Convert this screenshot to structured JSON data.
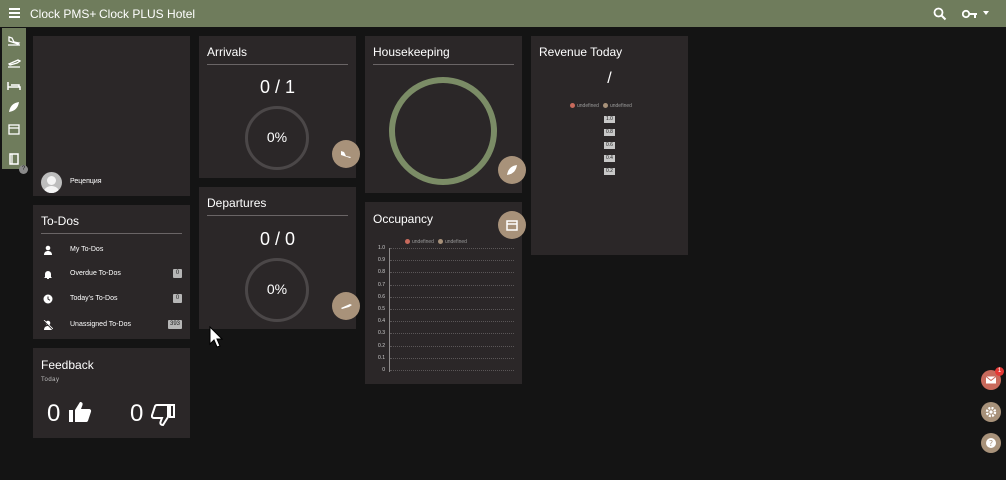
{
  "header": {
    "menu_icon": "menu-icon",
    "app_name": "Clock PMS+",
    "hotel_name": "Clock PLUS Hotel",
    "search_icon": "search-icon",
    "key_icon": "key-icon",
    "caret_icon": "caret-down-icon",
    "bar_color": "#6f7c5c"
  },
  "rail": {
    "items": [
      "plane-landing-icon",
      "plane-takeoff-icon",
      "bed-icon",
      "leaf-icon",
      "calendar-icon",
      "book-icon"
    ],
    "help_badge": "?"
  },
  "profile": {
    "user_name": "Рецепция"
  },
  "todos": {
    "title": "To-Dos",
    "items": [
      {
        "label": "My To-Dos",
        "icon": "person-icon",
        "badge": ""
      },
      {
        "label": "Overdue To-Dos",
        "icon": "bell-icon",
        "badge": "0"
      },
      {
        "label": "Today's To-Dos",
        "icon": "clock-icon",
        "badge": "0"
      },
      {
        "label": "Unassigned To-Dos",
        "icon": "person-off-icon",
        "badge": "393"
      }
    ]
  },
  "feedback": {
    "title": "Feedback",
    "period": "Today",
    "positive": "0",
    "negative": "0"
  },
  "arrivals": {
    "title": "Arrivals",
    "count": "0 / 1",
    "percent": "0%",
    "progress": 0
  },
  "departures": {
    "title": "Departures",
    "count": "0 / 0",
    "percent": "0%",
    "progress": 0
  },
  "housekeeping": {
    "title": "Housekeeping",
    "ring_color": "#7b8c66"
  },
  "occupancy": {
    "title": "Occupancy",
    "legend": [
      {
        "label": "undefined",
        "color": "#c86a5c"
      },
      {
        "label": "undefined",
        "color": "#a8927a"
      }
    ]
  },
  "revenue": {
    "title": "Revenue Today",
    "value": "/",
    "legend": [
      {
        "label": "undefined",
        "color": "#c86a5c"
      },
      {
        "label": "undefined",
        "color": "#a8927a"
      }
    ],
    "ticks": [
      "1.0",
      "0.8",
      "0.6",
      "0.4",
      "0.2"
    ]
  },
  "chart_data": {
    "type": "line",
    "title": "Occupancy",
    "series": [],
    "yticks": [
      "1.0",
      "0.9",
      "0.8",
      "0.7",
      "0.6",
      "0.5",
      "0.4",
      "0.3",
      "0.2",
      "0.1",
      "0"
    ],
    "ylim": [
      0,
      1
    ],
    "grid": true,
    "legend_position": "top"
  },
  "side_actions": {
    "mail_badge": "1",
    "mail_color": "#c86a5c",
    "settings_color": "#a8927a",
    "help_color": "#a8927a"
  },
  "colors": {
    "accent": "#a8927a",
    "card": "#2b2728",
    "background": "#141414"
  }
}
